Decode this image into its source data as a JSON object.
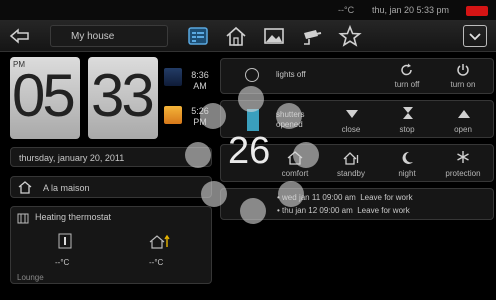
{
  "status": {
    "temperature": "--°C",
    "datetime": "thu, jan 20  5:33 pm",
    "battery_color": "#d51414"
  },
  "topbar": {
    "title": "My house",
    "icons": [
      "back-arrow-icon",
      "dashboard-icon",
      "home-icon",
      "image-icon",
      "camera-icon",
      "star-icon",
      "menu-dropdown-icon"
    ],
    "accent": "#5aa8e0"
  },
  "clock": {
    "period": "PM",
    "hours": "05",
    "minutes": "33",
    "sunrise": "8:36 AM",
    "sunset": "5:26 PM"
  },
  "date_text": "thursday, january 20, 2011",
  "location": "A la maison",
  "thermostat": {
    "title": "Heating thermostat",
    "value1": "--°C",
    "value2": "--°C",
    "room": "Lounge"
  },
  "lights": {
    "label": "lights off",
    "turn_off": "turn off",
    "turn_on": "turn on"
  },
  "shutters": {
    "label": "shutters opened",
    "close": "close",
    "stop": "stop",
    "open": "open"
  },
  "modes": {
    "temperature": "26",
    "comfort": "comfort",
    "standby": "standby",
    "night": "night",
    "protection": "protection"
  },
  "schedule": [
    {
      "day": "wed",
      "date": "jan 11 09:00 am",
      "text": "Leave for work"
    },
    {
      "day": "thu",
      "date": "jan 12 09:00 am",
      "text": "Leave for work"
    }
  ]
}
